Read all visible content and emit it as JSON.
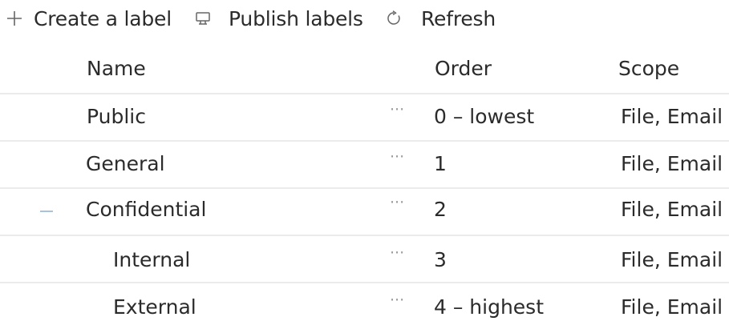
{
  "toolbar": {
    "create": {
      "icon": "plus-icon",
      "label": "Create a label"
    },
    "publish": {
      "icon": "publish-icon",
      "label": "Publish labels"
    },
    "refresh": {
      "icon": "refresh-icon",
      "label": "Refresh"
    }
  },
  "table": {
    "columns": [
      "Name",
      "Order",
      "Scope"
    ],
    "rows": [
      {
        "name": "Public",
        "more": "···",
        "order": "0 – lowest",
        "scope": "File, Email"
      },
      {
        "name": "General",
        "more": "···",
        "order": "1",
        "scope": "File, Email"
      },
      {
        "name": "Confidential",
        "more": "···",
        "order": "2",
        "scope": "File, Email",
        "expanded": true
      },
      {
        "name": "Internal",
        "more": "···",
        "order": "3",
        "scope": "File, Email",
        "level": 1
      },
      {
        "name": "External",
        "more": "···",
        "order": "4 – highest",
        "scope": "File, Email",
        "level": 1
      }
    ]
  }
}
